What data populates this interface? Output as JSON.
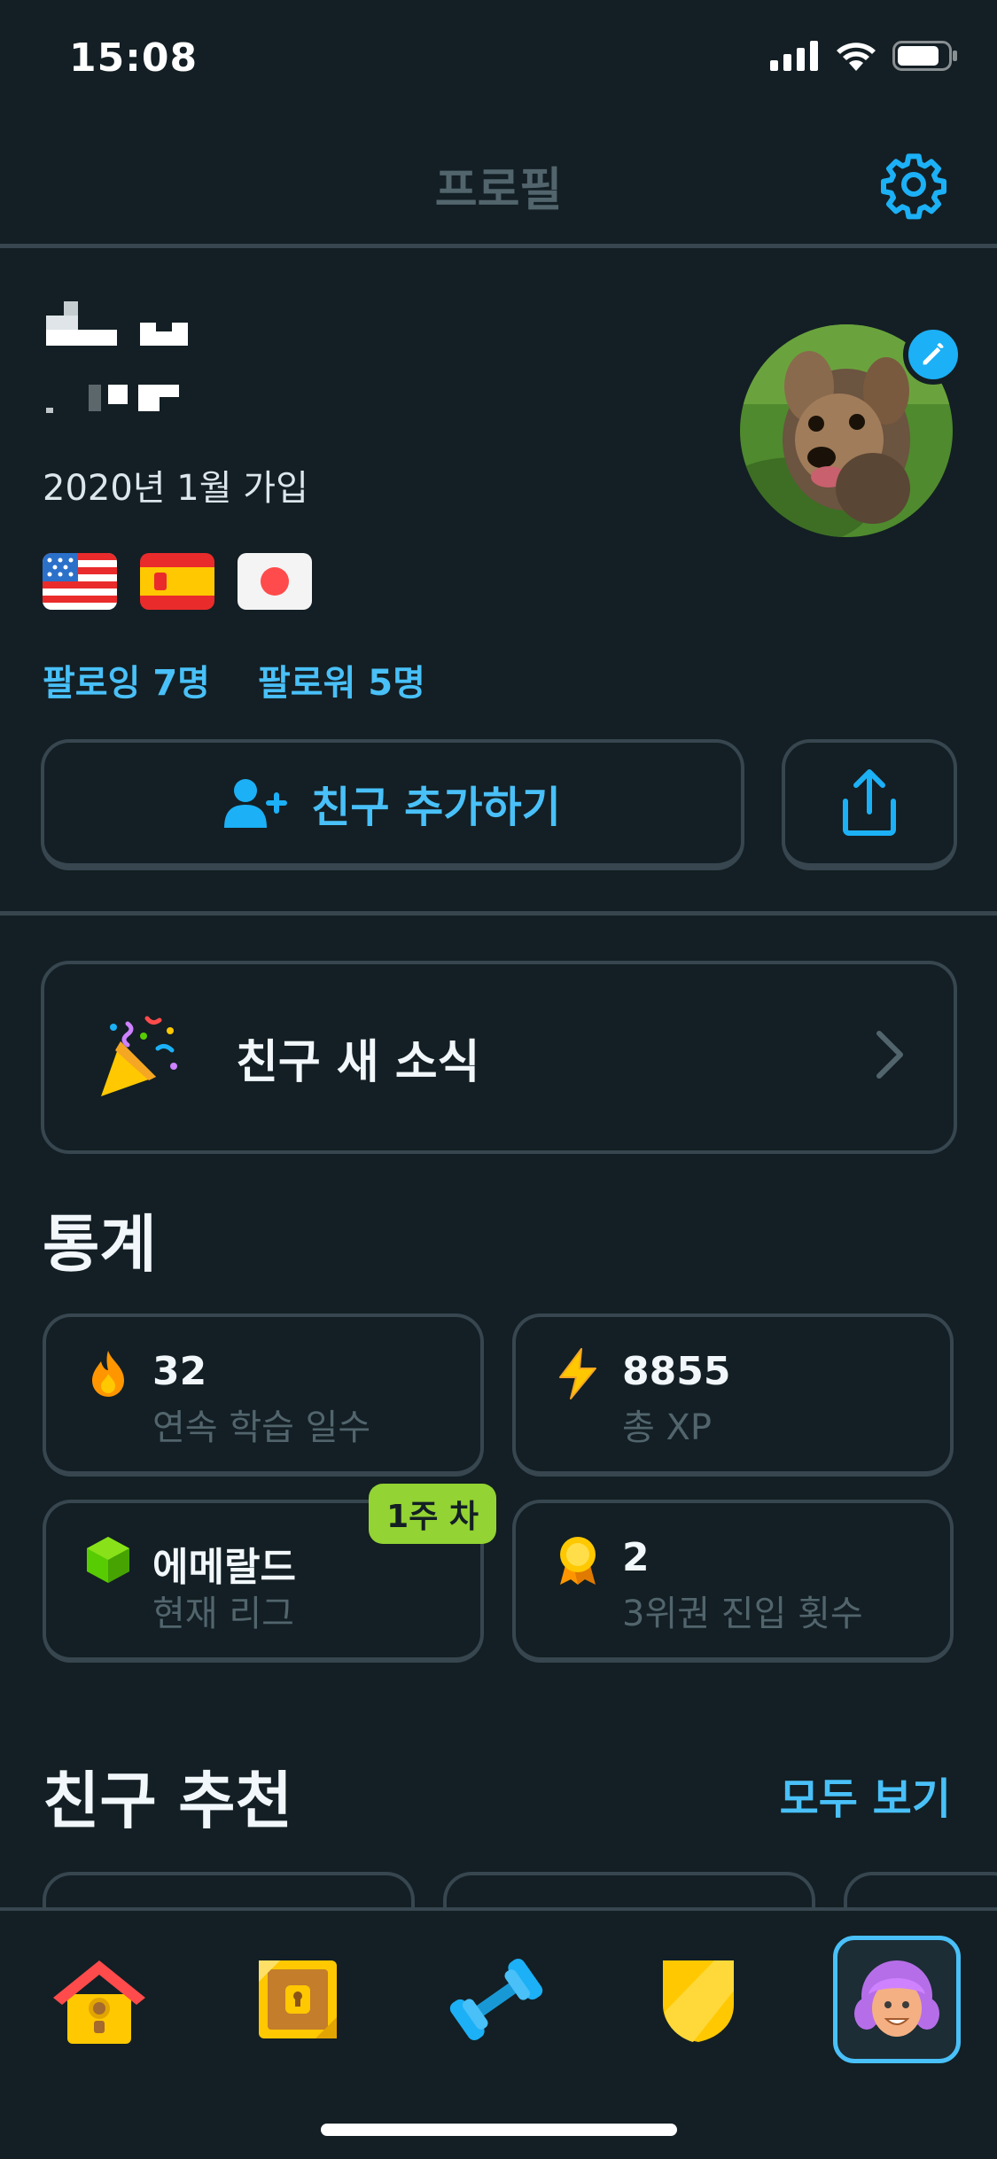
{
  "status_bar": {
    "time": "15:08"
  },
  "header": {
    "title": "프로필"
  },
  "profile": {
    "joined": "2020년 1월 가입",
    "flags": [
      "us-flag-icon",
      "es-flag-icon",
      "jp-flag-icon"
    ],
    "following": "팔로잉 7명",
    "followers": "팔로워 5명"
  },
  "actions": {
    "add_friend": "친구 추가하기"
  },
  "friend_news": {
    "label": "친구 새 소식"
  },
  "stats": {
    "title": "통계",
    "streak": {
      "value": "32",
      "label": "연속 학습 일수"
    },
    "xp": {
      "value": "8855",
      "label": "총 XP"
    },
    "league": {
      "value": "에메랄드",
      "label": "현재 리그",
      "badge": "1주 차"
    },
    "top3": {
      "value": "2",
      "label": "3위권 진입 횟수"
    }
  },
  "suggestions": {
    "title": "친구 추천",
    "see_all": "모두 보기"
  },
  "tabbar": {
    "items": [
      "home-icon",
      "chest-icon",
      "dumbbell-icon",
      "shield-icon",
      "profile-avatar-icon"
    ],
    "active": "profile-avatar-icon"
  },
  "colors": {
    "background": "#131f24",
    "accent": "#49c0f8",
    "border": "#37464f",
    "muted": "#52656d",
    "lime": "#93d333"
  }
}
